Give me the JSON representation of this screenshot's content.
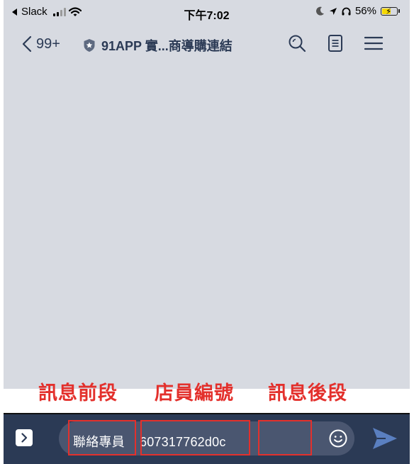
{
  "status_bar": {
    "back_app": "Slack",
    "time": "下午7:02",
    "battery_percent": "56%"
  },
  "header": {
    "back_count": "99+",
    "title": "91APP 實...商導購連結"
  },
  "annotations": {
    "prefix": "訊息前段",
    "staff_id": "店員編號",
    "suffix": "訊息後段"
  },
  "input": {
    "prefix_text": "聯絡專員",
    "staff_id_text": "607317762d0c",
    "suffix_text": ""
  },
  "colors": {
    "chat_background": "#d7dae1",
    "header_text": "#2b3a55",
    "input_bar": "#2b3a55",
    "annotation_red": "#e3302c"
  },
  "icons": {
    "status": [
      "back-arrow-icon",
      "signal-icon",
      "wifi-icon",
      "moon-icon",
      "location-icon",
      "headphones-icon",
      "battery-icon"
    ],
    "header": [
      "chevron-left-icon",
      "shield-icon",
      "search-icon",
      "notes-icon",
      "menu-icon"
    ],
    "input_bar": [
      "chevron-right-icon",
      "emoji-icon",
      "send-icon"
    ]
  }
}
